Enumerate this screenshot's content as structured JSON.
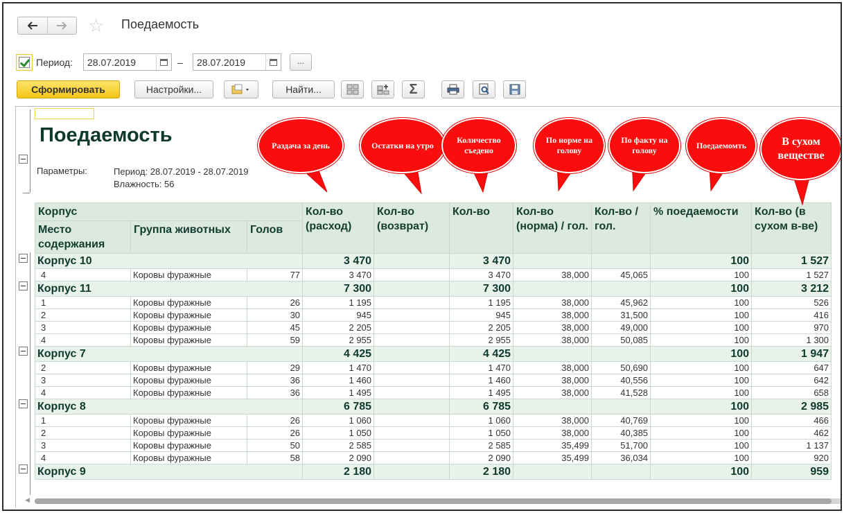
{
  "window": {
    "title": "Поедаемость",
    "back_icon": "arrow-left-icon",
    "forward_icon": "arrow-right-icon",
    "favorite_icon": "star-icon"
  },
  "period": {
    "label": "Период:",
    "checked": true,
    "date_from": "28.07.2019",
    "separator": "–",
    "date_to": "28.07.2019",
    "more_label": "..."
  },
  "toolbar": {
    "generate_label": "Сформировать",
    "settings_label": "Настройки...",
    "find_label": "Найти...",
    "sum_symbol": "Σ"
  },
  "report": {
    "title": "Поедаемость",
    "params_label": "Параметры:",
    "params_period": "Период: 28.07.2019 - 28.07.2019",
    "params_humidity": "Влажность: 56",
    "headers": {
      "korpus": "Корпус",
      "mesto": "Место содержания",
      "gruppa": "Группа животных",
      "golov": "Голов",
      "rashod": "Кол-во (расход)",
      "vozvrat": "Кол-во (возврат)",
      "kolvo": "Кол-во",
      "norma": "Кол-во (норма) / гол.",
      "na_gol": "Кол-во / гол.",
      "poedaemost": "% поедаемости",
      "suhoe": "Кол-во (в сухом в-ве)"
    },
    "groups": [
      {
        "name": "Корпус 10",
        "rashod": "3 470",
        "kolvo": "3 470",
        "pct": "100",
        "suhoe": "1 527",
        "rows": [
          {
            "mesto": "4",
            "gruppa": "Коровы фуражные",
            "golov": "77",
            "rashod": "3 470",
            "kolvo": "3 470",
            "norma": "38,000",
            "na_gol": "45,065",
            "pct": "100",
            "suhoe": "1 527"
          }
        ]
      },
      {
        "name": "Корпус 11",
        "rashod": "7 300",
        "kolvo": "7 300",
        "pct": "100",
        "suhoe": "3 212",
        "rows": [
          {
            "mesto": "1",
            "gruppa": "Коровы фуражные",
            "golov": "26",
            "rashod": "1 195",
            "kolvo": "1 195",
            "norma": "38,000",
            "na_gol": "45,962",
            "pct": "100",
            "suhoe": "526"
          },
          {
            "mesto": "2",
            "gruppa": "Коровы фуражные",
            "golov": "30",
            "rashod": "945",
            "kolvo": "945",
            "norma": "38,000",
            "na_gol": "31,500",
            "pct": "100",
            "suhoe": "416"
          },
          {
            "mesto": "3",
            "gruppa": "Коровы фуражные",
            "golov": "45",
            "rashod": "2 205",
            "kolvo": "2 205",
            "norma": "38,000",
            "na_gol": "49,000",
            "pct": "100",
            "suhoe": "970"
          },
          {
            "mesto": "4",
            "gruppa": "Коровы фуражные",
            "golov": "59",
            "rashod": "2 955",
            "kolvo": "2 955",
            "norma": "38,000",
            "na_gol": "50,085",
            "pct": "100",
            "suhoe": "1 300"
          }
        ]
      },
      {
        "name": "Корпус 7",
        "rashod": "4 425",
        "kolvo": "4 425",
        "pct": "100",
        "suhoe": "1 947",
        "rows": [
          {
            "mesto": "2",
            "gruppa": "Коровы фуражные",
            "golov": "29",
            "rashod": "1 470",
            "kolvo": "1 470",
            "norma": "38,000",
            "na_gol": "50,690",
            "pct": "100",
            "suhoe": "647"
          },
          {
            "mesto": "3",
            "gruppa": "Коровы фуражные",
            "golov": "36",
            "rashod": "1 460",
            "kolvo": "1 460",
            "norma": "38,000",
            "na_gol": "40,556",
            "pct": "100",
            "suhoe": "642"
          },
          {
            "mesto": "4",
            "gruppa": "Коровы фуражные",
            "golov": "36",
            "rashod": "1 495",
            "kolvo": "1 495",
            "norma": "38,000",
            "na_gol": "41,528",
            "pct": "100",
            "suhoe": "658"
          }
        ]
      },
      {
        "name": "Корпус 8",
        "rashod": "6 785",
        "kolvo": "6 785",
        "pct": "100",
        "suhoe": "2 985",
        "rows": [
          {
            "mesto": "1",
            "gruppa": "Коровы фуражные",
            "golov": "26",
            "rashod": "1 060",
            "kolvo": "1 060",
            "norma": "38,000",
            "na_gol": "40,769",
            "pct": "100",
            "suhoe": "466"
          },
          {
            "mesto": "2",
            "gruppa": "Коровы фуражные",
            "golov": "26",
            "rashod": "1 050",
            "kolvo": "1 050",
            "norma": "38,000",
            "na_gol": "40,385",
            "pct": "100",
            "suhoe": "462"
          },
          {
            "mesto": "3",
            "gruppa": "Коровы фуражные",
            "golov": "50",
            "rashod": "2 585",
            "kolvo": "2 585",
            "norma": "35,499",
            "na_gol": "51,700",
            "pct": "100",
            "suhoe": "1 137"
          },
          {
            "mesto": "4",
            "gruppa": "Коровы фуражные",
            "golov": "58",
            "rashod": "2 090",
            "kolvo": "2 090",
            "norma": "35,499",
            "na_gol": "36,034",
            "pct": "100",
            "suhoe": "920"
          }
        ]
      },
      {
        "name": "Корпус 9",
        "rashod": "2 180",
        "kolvo": "2 180",
        "pct": "100",
        "suhoe": "959",
        "rows": []
      }
    ]
  },
  "callouts": [
    {
      "text": "Раздача за день"
    },
    {
      "text": "Остатки на утро"
    },
    {
      "text": "Количество съедено"
    },
    {
      "text": "По норме на голову"
    },
    {
      "text": "По факту на голову"
    },
    {
      "text": "Поедаемомть"
    },
    {
      "text": "В сухом веществе"
    }
  ],
  "colors": {
    "accent_yellow": "#f5c517",
    "header_green": "#dce9df",
    "group_green": "#e8f1ea",
    "title_green": "#0e3a2c",
    "callout_red": "#fc0d0d"
  }
}
